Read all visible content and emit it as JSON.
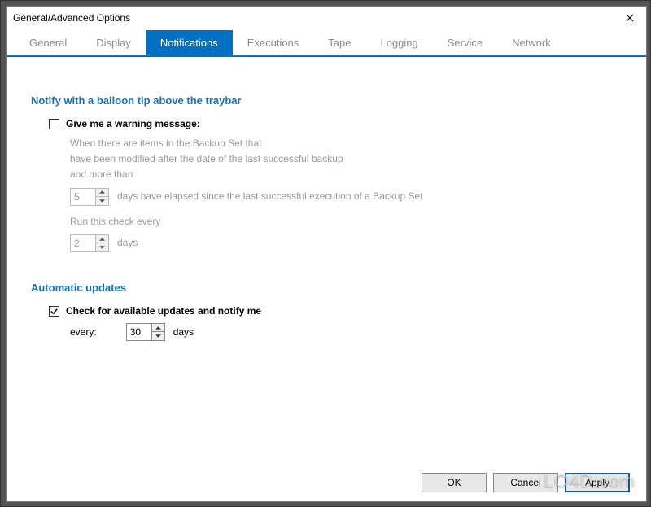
{
  "window": {
    "title": "General/Advanced Options"
  },
  "tabs": [
    {
      "label": "General"
    },
    {
      "label": "Display"
    },
    {
      "label": "Notifications"
    },
    {
      "label": "Executions"
    },
    {
      "label": "Tape"
    },
    {
      "label": "Logging"
    },
    {
      "label": "Service"
    },
    {
      "label": "Network"
    }
  ],
  "section1": {
    "title": "Notify with a balloon tip above the traybar",
    "checkbox_label": "Give me a warning message:",
    "desc1": "When there are items in the Backup Set that",
    "desc2": "have been modified after the date of the last successful backup",
    "desc3": "and more than",
    "days_value": "5",
    "desc4": "days have elapsed since the last successful execution of a Backup Set",
    "desc5": "Run this check every",
    "check_value": "2",
    "desc6": "days"
  },
  "section2": {
    "title": "Automatic updates",
    "checkbox_label": "Check for available updates and notify me",
    "every_label": "every:",
    "every_value": "30",
    "days_label": "days"
  },
  "buttons": {
    "ok": "OK",
    "cancel": "Cancel",
    "apply": "Apply"
  },
  "watermark": "LO4D.com"
}
